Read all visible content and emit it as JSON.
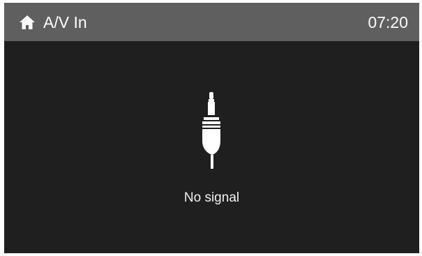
{
  "header": {
    "title": "A/V In",
    "time": "07:20",
    "home_icon": "home-icon"
  },
  "main": {
    "status_text": "No signal",
    "status_icon": "audio-jack-icon"
  },
  "colors": {
    "screen_bg": "#1f1f1f",
    "header_bg": "#5f5f5f",
    "text": "#ffffff"
  }
}
